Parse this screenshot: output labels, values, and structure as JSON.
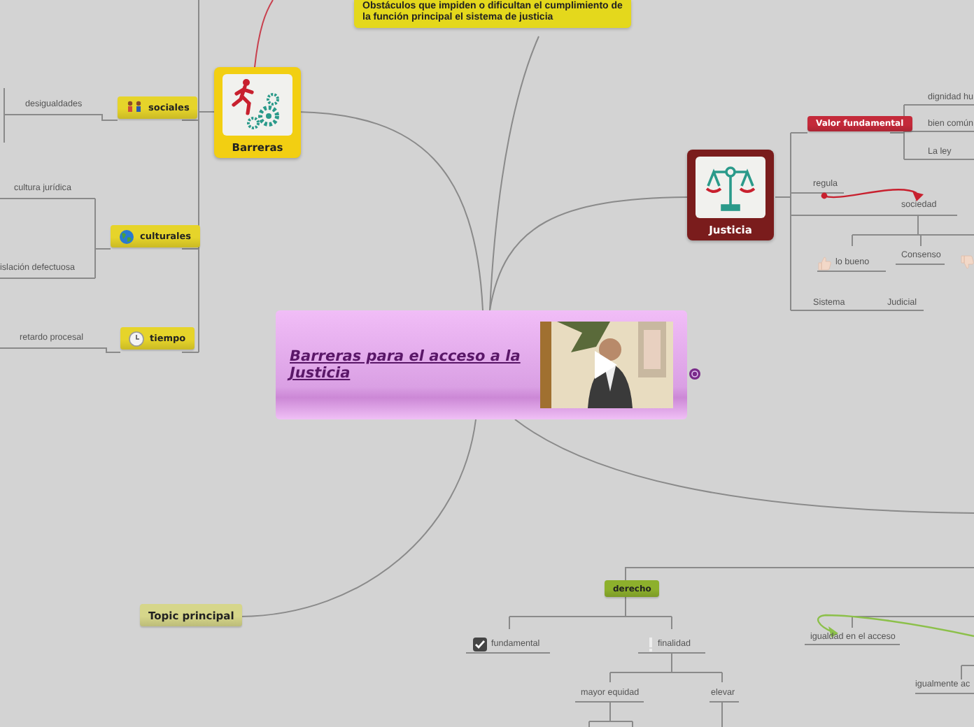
{
  "central_topic": {
    "title": "Barreras para el acceso a la Justicia"
  },
  "nodes": [
    {
      "kind": "callout",
      "label": "Obstáculos que impiden o dificultan el cumplimiento de la función principal el sistema de justicia",
      "color": "#e4d81c"
    },
    {
      "kind": "image-topic",
      "label": "Barreras",
      "color": "#f2cf12"
    },
    {
      "kind": "tag",
      "label": "sociales",
      "color": "#e6d42a"
    },
    {
      "kind": "text",
      "label": "desigualdades"
    },
    {
      "kind": "text",
      "label": "cultura jurídica"
    },
    {
      "kind": "tag",
      "label": "culturales",
      "color": "#e6d42a"
    },
    {
      "kind": "text",
      "label": "islación defectuosa"
    },
    {
      "kind": "tag",
      "label": "tiempo",
      "color": "#e6d42a"
    },
    {
      "kind": "text",
      "label": "retardo procesal"
    },
    {
      "kind": "image-topic",
      "label": "Justicia",
      "color": "#7a1c1c"
    },
    {
      "kind": "tag",
      "label": "Valor fundamental",
      "color": "#c42a3a"
    },
    {
      "kind": "text",
      "label": "dignidad hu"
    },
    {
      "kind": "text",
      "label": "bien común"
    },
    {
      "kind": "text",
      "label": "La ley"
    },
    {
      "kind": "text",
      "label": "regula"
    },
    {
      "kind": "text",
      "label": "sociedad"
    },
    {
      "kind": "text",
      "label": "lo bueno"
    },
    {
      "kind": "text",
      "label": "Consenso"
    },
    {
      "kind": "text",
      "label": "Sistema"
    },
    {
      "kind": "text",
      "label": "Judicial"
    },
    {
      "kind": "tag",
      "label": "Topic principal",
      "color": "#d6d68a"
    },
    {
      "kind": "tag",
      "label": "derecho",
      "color": "#8db02c"
    },
    {
      "kind": "text",
      "label": "fundamental"
    },
    {
      "kind": "text",
      "label": "finalidad"
    },
    {
      "kind": "text",
      "label": "igualdad en el acceso"
    },
    {
      "kind": "text",
      "label": "mayor equidad"
    },
    {
      "kind": "text",
      "label": "elevar"
    },
    {
      "kind": "text",
      "label": "igualmente ac"
    }
  ]
}
